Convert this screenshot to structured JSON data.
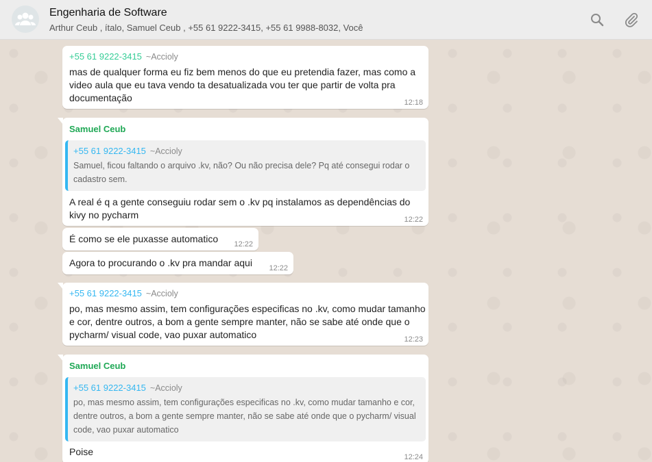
{
  "header": {
    "title": "Engenharia de Software",
    "participants": "Arthur Ceub , ítalo, Samuel Ceub , +55 61 9222-3415, +55 61 9988-8032, Você",
    "icons": [
      "group-avatar-icon",
      "search-icon",
      "attach-icon"
    ]
  },
  "messages": [
    {
      "sender_number": "+55 61 9222-3415",
      "sender_alias": "~Accioly",
      "text": "mas de qualquer forma eu fiz bem menos do que eu pretendia fazer, mas como a video aula que eu tava vendo ta desatualizada vou ter que partir de volta pra documentação",
      "time": "12:18"
    },
    {
      "sender_name": "Samuel Ceub",
      "quote_number": "+55 61 9222-3415",
      "quote_alias": "~Accioly",
      "quote_text": "Samuel, ficou faltando o arquivo .kv, não? Ou não precisa dele? Pq até consegui rodar o cadastro sem.",
      "text": "A real é q a gente conseguiu rodar sem o .kv pq instalamos as dependências do kivy no pycharm",
      "time": "12:22"
    },
    {
      "text": "É como se ele puxasse automatico",
      "time": "12:22"
    },
    {
      "text": "Agora to procurando o .kv pra mandar aqui",
      "time": "12:22"
    },
    {
      "sender_number": "+55 61 9222-3415",
      "sender_alias": "~Accioly",
      "text": "po, mas mesmo assim, tem configurações especificas no .kv, como mudar tamanho e cor, dentre outros, a bom a gente sempre manter, não se sabe até onde que o pycharm/ visual code, vao puxar automatico",
      "time": "12:23"
    },
    {
      "sender_name": "Samuel Ceub",
      "quote_number": "+55 61 9222-3415",
      "quote_alias": "~Accioly",
      "quote_text": "po, mas mesmo assim, tem configurações especificas no .kv, como mudar tamanho e cor, dentre outros, a bom a gente sempre manter, não se sabe até onde que o pycharm/ visual code, vao puxar automatico",
      "text": "Poise",
      "time": "12:24"
    }
  ]
}
